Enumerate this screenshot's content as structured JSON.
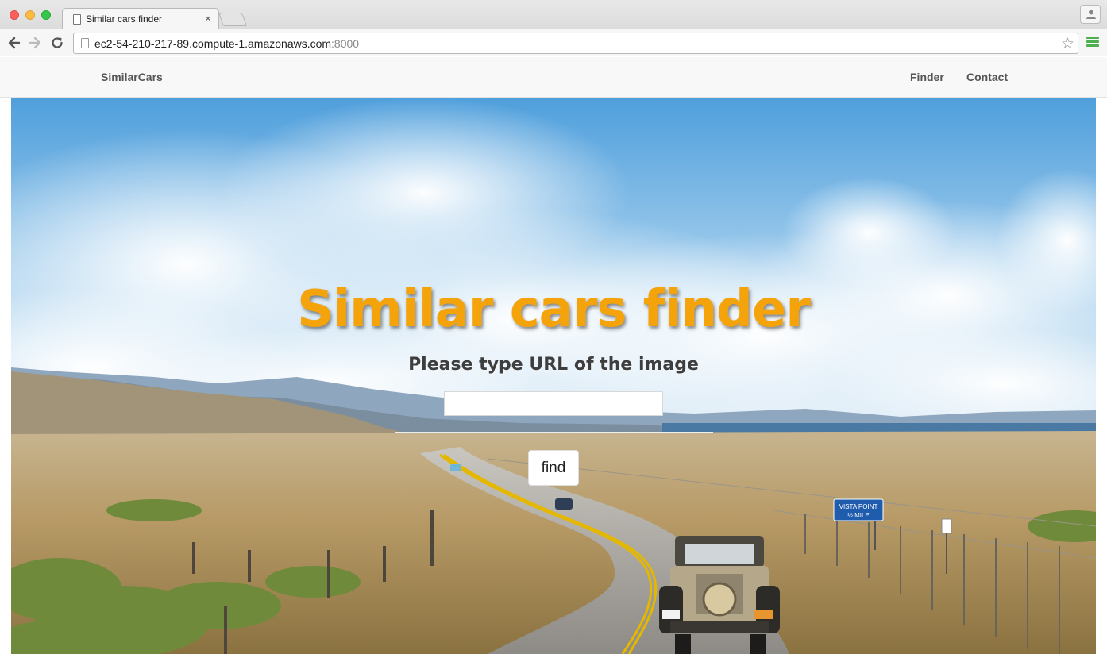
{
  "browser": {
    "tab_title": "Similar cars finder",
    "tab_close": "×",
    "url_host": "ec2-54-210-217-89.compute-1.amazonaws.com",
    "url_port": ":8000",
    "bookmark_star": "☆"
  },
  "navbar": {
    "brand": "SimilarCars",
    "links": [
      {
        "label": "Finder"
      },
      {
        "label": "Contact"
      }
    ]
  },
  "hero": {
    "title": "Similar cars finder",
    "subtitle": "Please type URL of the image",
    "input_value": "",
    "input_placeholder": "",
    "button_label": "find"
  },
  "scene": {
    "sign_line1": "VISTA POINT",
    "sign_line2": "½ MILE"
  },
  "colors": {
    "title": "#f5a30b",
    "sky_top": "#5aa6e0",
    "sign_blue": "#1f5cae",
    "menu_green": "#4caf50"
  }
}
